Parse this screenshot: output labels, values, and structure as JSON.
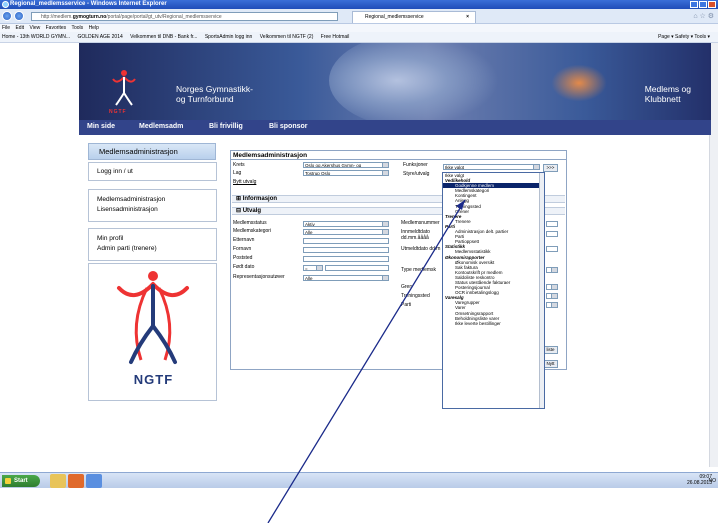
{
  "window": {
    "title": "Regional_medlemsservice - Windows Internet Explorer"
  },
  "addressbar": {
    "url_prefix": "http://medlem.",
    "url_domain": "gymogturn.no",
    "url_rest": "/portal/page/portal/gt_utv/Regional_medlemsservice"
  },
  "browser_tab": {
    "label": "Regional_medlemsservice",
    "close": "×"
  },
  "menubar": {
    "items": [
      "File",
      "Edit",
      "View",
      "Favorites",
      "Tools",
      "Help"
    ]
  },
  "favorites": {
    "items": [
      "Home - 13th WORLD GYMN...",
      "GOLDEN AGE 2014",
      "Velkommen til DNB - Bank fr...",
      "SportsAdmin logg inn",
      "Velkommen til NGTF (2)",
      "Free Hotmail"
    ],
    "right_tools": "Page ▾  Safety ▾  Tools ▾"
  },
  "banner": {
    "logo_text": "NGTF",
    "org_line1": "Norges Gymnastikk-",
    "org_line2": "og Turnforbund",
    "club_line1": "Medlems og",
    "club_line2": "Klubbnett"
  },
  "nav": {
    "items": [
      "Min side",
      "Medlemsadm",
      "Bli frivillig",
      "Bli sponsor"
    ]
  },
  "sidebar": {
    "heading": "Medlemsadministrasjon",
    "login": "Logg inn / ut",
    "links1": [
      "Medlemsadministrasjon",
      "Lisensadministrasjon"
    ],
    "links2": [
      "Min profil",
      "Admin parti (trenere)"
    ],
    "logo_text": "NGTF"
  },
  "main": {
    "heading": "Medlemsadministrasjon",
    "krets_label": "Krets",
    "krets_value": "Oslo og Akershus Gymn- og",
    "lag_label": "Lag",
    "lag_value": "Tostrup Oslo",
    "byttutvalg": "Bytt utvalg",
    "funksjoner_label": "Funksjoner",
    "funksjoner_value": "Ikke valgt",
    "styreutvalg_label": "Styre/utvalg",
    "go_label": ">>>",
    "section_info": "Informasjon",
    "section_utvalg": "Utvalg",
    "left_labels": [
      "Medlemsstatus",
      "Medlemskategori",
      "Etternavn",
      "Fornavn",
      "Poststed",
      "Født dato",
      "Representasjonsutøver"
    ],
    "left_values": {
      "status": "Aktiv",
      "kategori": "Alle",
      "fodt_op": "=",
      "repr": "Alle"
    },
    "right_labels": [
      "Medlemsnummer",
      "Innmeldtdato",
      "dd.mm.åååå",
      "Utmeldtdato dd.m",
      "Type medlemsk",
      "Gren",
      "Treningssted",
      "Parti"
    ],
    "btn1": "liste",
    "btn2": "Nytt"
  },
  "dropdown": {
    "items": [
      {
        "t": "Ikke valgt",
        "k": "plain"
      },
      {
        "t": "Vedlikehold",
        "k": "grp"
      },
      {
        "t": "Godkjenne medlem",
        "k": "hl"
      },
      {
        "t": "Medlemskategori",
        "k": "ind"
      },
      {
        "t": "Kontingent",
        "k": "ind"
      },
      {
        "t": "Anlegg",
        "k": "ind"
      },
      {
        "t": "Treningssted",
        "k": "ind"
      },
      {
        "t": "Grener",
        "k": "ind"
      },
      {
        "t": "Trenere",
        "k": "grp"
      },
      {
        "t": "Trenere",
        "k": "ind"
      },
      {
        "t": "Parti",
        "k": "grp"
      },
      {
        "t": "Administrasjon delt. partier",
        "k": "ind"
      },
      {
        "t": "Parti",
        "k": "ind"
      },
      {
        "t": "Partioppsett",
        "k": "ind"
      },
      {
        "t": "Statistikk",
        "k": "grp"
      },
      {
        "t": "Medlemsstatistikk",
        "k": "ind"
      },
      {
        "t": "Økonomirapporter",
        "k": "grp"
      },
      {
        "t": "Økonomisk oversikt",
        "k": "ind"
      },
      {
        "t": "Sak faktura",
        "k": "ind"
      },
      {
        "t": "Kontoutskrift pr medlem",
        "k": "ind"
      },
      {
        "t": "Saldoliste reskontro",
        "k": "ind"
      },
      {
        "t": "Status utestående fakturaer",
        "k": "ind"
      },
      {
        "t": "Posteringsjournal",
        "k": "ind"
      },
      {
        "t": "OCR innbetalingslogg",
        "k": "ind"
      },
      {
        "t": "Varesalg",
        "k": "grp"
      },
      {
        "t": "Varegrupper",
        "k": "ind"
      },
      {
        "t": "Varer",
        "k": "ind"
      },
      {
        "t": "Omsetningsrapport",
        "k": "ind"
      },
      {
        "t": "Beholdningsliste varer",
        "k": "ind"
      },
      {
        "t": "Ikke leverte bestillinger",
        "k": "ind"
      }
    ]
  },
  "taskbar": {
    "start": "Start",
    "lang": "NO",
    "time": "09:07",
    "date": "26.08.2013"
  }
}
